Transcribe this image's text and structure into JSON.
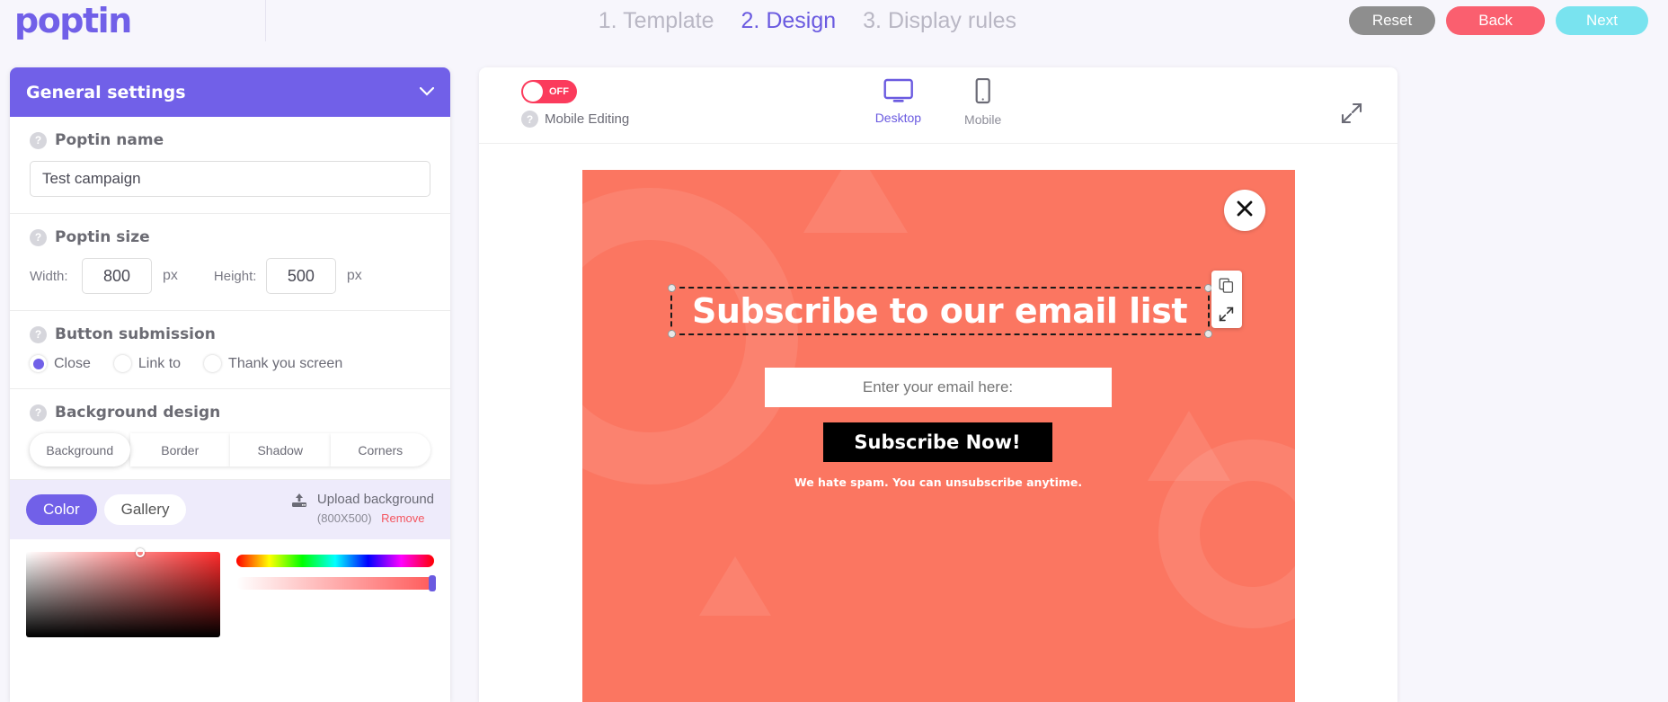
{
  "brand": {
    "logo_text": "poptin",
    "accent": "#7160e8"
  },
  "header": {
    "steps": [
      {
        "label": "1. Template",
        "active": false
      },
      {
        "label": "2. Design",
        "active": true
      },
      {
        "label": "3. Display rules",
        "active": false
      }
    ],
    "buttons": {
      "reset": "Reset",
      "back": "Back",
      "next": "Next"
    },
    "colors": {
      "reset": "#8e8e8e",
      "back": "#fa5f6f",
      "next": "#79e3ef"
    }
  },
  "sidebar": {
    "panel_title": "General settings",
    "collapse_icon": "chevron-down-icon",
    "poptin_name": {
      "label": "Poptin name",
      "value": "Test campaign"
    },
    "poptin_size": {
      "label": "Poptin size",
      "width_label": "Width:",
      "width_value": "800",
      "width_unit": "px",
      "height_label": "Height:",
      "height_value": "500",
      "height_unit": "px"
    },
    "button_submission": {
      "label": "Button submission",
      "options": [
        {
          "label": "Close",
          "selected": true
        },
        {
          "label": "Link to",
          "selected": false
        },
        {
          "label": "Thank you screen",
          "selected": false
        }
      ]
    },
    "background_design": {
      "label": "Background design",
      "tabs": [
        {
          "label": "Background",
          "active": true
        },
        {
          "label": "Border",
          "active": false
        },
        {
          "label": "Shadow",
          "active": false
        },
        {
          "label": "Corners",
          "active": false
        }
      ],
      "source_pills": [
        {
          "label": "Color",
          "active": true
        },
        {
          "label": "Gallery",
          "active": false
        }
      ],
      "upload": {
        "icon": "upload-icon",
        "title": "Upload background",
        "dimensions": "(800X500)",
        "remove_label": "Remove",
        "remove_color": "#f4555f"
      }
    }
  },
  "canvas": {
    "mobile_editing": {
      "label": "Mobile Editing",
      "state": "OFF",
      "toggle_color": "#fb3b5c"
    },
    "devices": [
      {
        "label": "Desktop",
        "icon": "desktop-icon",
        "active": true
      },
      {
        "label": "Mobile",
        "icon": "mobile-icon",
        "active": false
      }
    ],
    "expand_icon": "expand-icon"
  },
  "popup": {
    "background_color": "#fb7661",
    "close_icon": "close-icon",
    "headline": "Subscribe to our email list",
    "email_placeholder": "Enter your email here:",
    "submit_label": "Subscribe Now!",
    "disclaimer": "We hate spam. You can unsubscribe anytime.",
    "element_tools": [
      {
        "icon": "duplicate-icon"
      },
      {
        "icon": "resize-icon"
      }
    ]
  }
}
